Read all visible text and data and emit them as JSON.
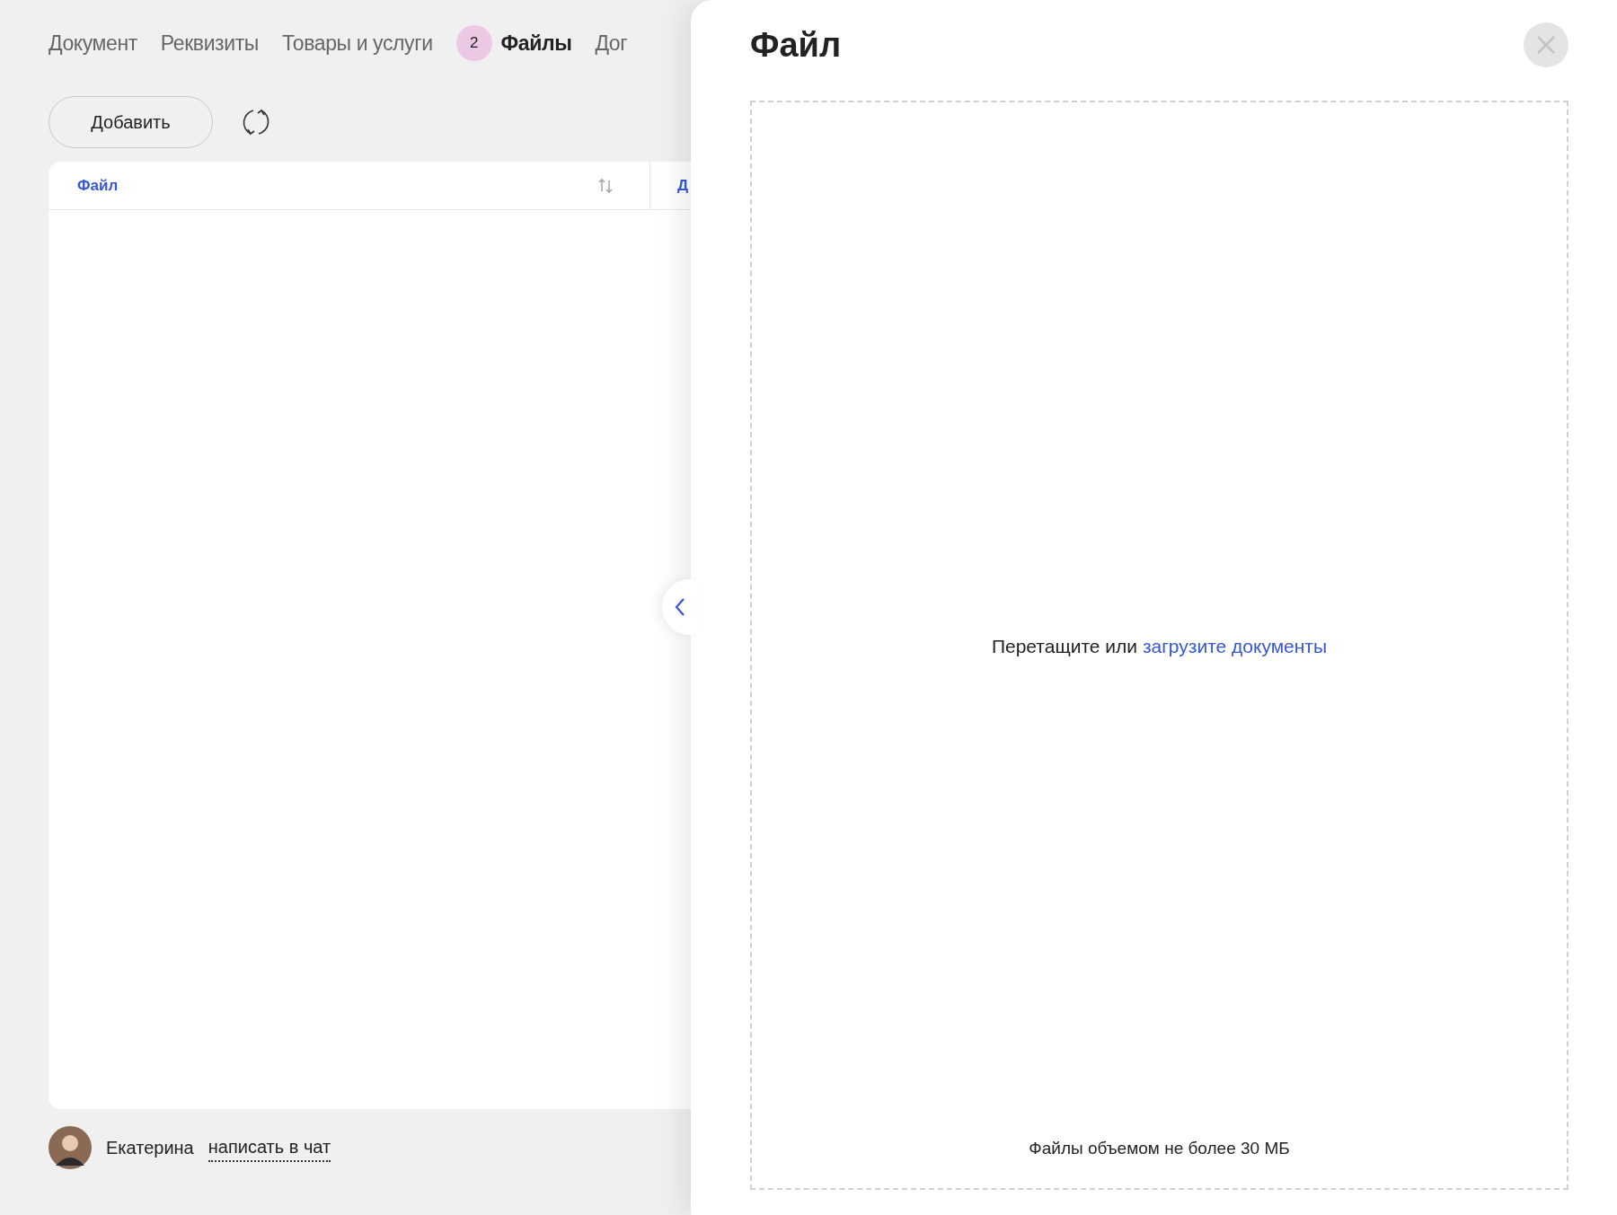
{
  "tabs": [
    {
      "label": "Документ",
      "selected": false
    },
    {
      "label": "Реквизиты",
      "selected": false
    },
    {
      "label": "Товары и услуги",
      "selected": false
    },
    {
      "label": "Файлы",
      "selected": true,
      "badge": "2"
    },
    {
      "label": "Дог",
      "selected": false
    }
  ],
  "toolbar": {
    "add_button": "Добавить"
  },
  "table": {
    "columns": [
      "Файл",
      "Д"
    ]
  },
  "footer": {
    "name": "Екатерина",
    "chat_link": "написать в чат"
  },
  "panel": {
    "title": "Файл",
    "dropzone": {
      "text": "Перетащите или",
      "link": "загрузите документы",
      "hint": "Файлы объемом не более 30 МБ"
    }
  }
}
